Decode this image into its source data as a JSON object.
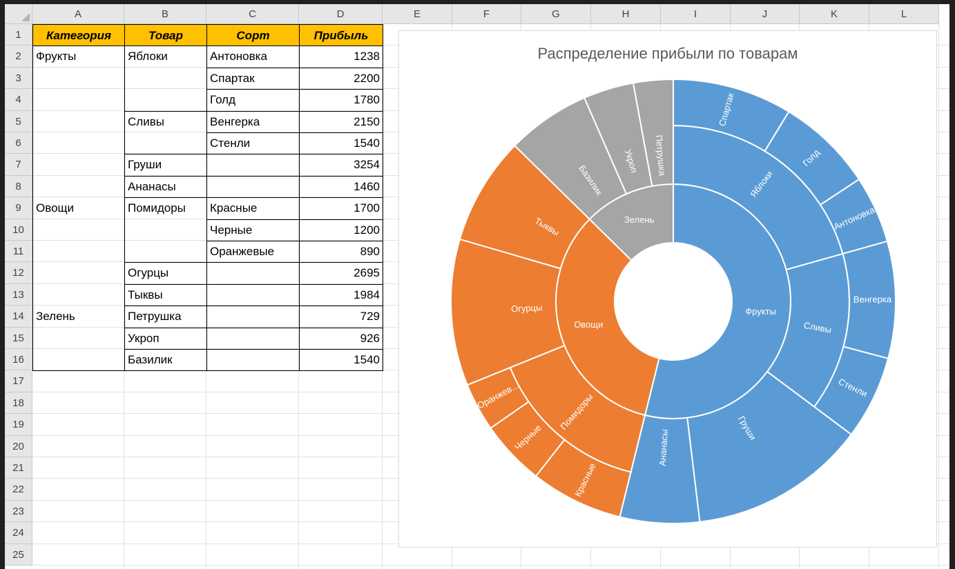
{
  "columns": [
    "A",
    "B",
    "C",
    "D",
    "E",
    "F",
    "G",
    "H",
    "I",
    "J",
    "K",
    "L"
  ],
  "rows": [
    "1",
    "2",
    "3",
    "4",
    "5",
    "6",
    "7",
    "8",
    "9",
    "10",
    "11",
    "12",
    "13",
    "14",
    "15",
    "16",
    "17",
    "18",
    "19",
    "20",
    "21",
    "22",
    "23",
    "24",
    "25"
  ],
  "table": {
    "headers": [
      "Категория",
      "Товар",
      "Сорт",
      "Прибыль"
    ],
    "rows": [
      [
        "Фрукты",
        "Яблоки",
        "Антоновка",
        "1238"
      ],
      [
        "",
        "",
        "Спартак",
        "2200"
      ],
      [
        "",
        "",
        "Голд",
        "1780"
      ],
      [
        "",
        "Сливы",
        "Венгерка",
        "2150"
      ],
      [
        "",
        "",
        "Стенли",
        "1540"
      ],
      [
        "",
        "Груши",
        "",
        "3254"
      ],
      [
        "",
        "Ананасы",
        "",
        "1460"
      ],
      [
        "Овощи",
        "Помидоры",
        "Красные",
        "1700"
      ],
      [
        "",
        "",
        "Черные",
        "1200"
      ],
      [
        "",
        "",
        "Оранжевые",
        "890"
      ],
      [
        "",
        "Огурцы",
        "",
        "2695"
      ],
      [
        "",
        "Тыквы",
        "",
        "1984"
      ],
      [
        "Зелень",
        "Петрушка",
        "",
        "729"
      ],
      [
        "",
        "Укроп",
        "",
        "926"
      ],
      [
        "",
        "Базилик",
        "",
        "1540"
      ]
    ]
  },
  "colors": {
    "fruits": "#5b9bd5",
    "vegetables": "#ed7d31",
    "greens": "#a5a5a5",
    "header_fill": "#ffc000"
  },
  "chart_data": {
    "type": "sunburst",
    "title": "Распределение прибыли по товарам",
    "hierarchy": [
      {
        "name": "Фрукты",
        "color": "#5b9bd5",
        "children": [
          {
            "name": "Яблоки",
            "children": [
              {
                "name": "Спартак",
                "value": 2200
              },
              {
                "name": "Голд",
                "value": 1780
              },
              {
                "name": "Антоновка",
                "value": 1238
              }
            ]
          },
          {
            "name": "Сливы",
            "children": [
              {
                "name": "Венгерка",
                "value": 2150
              },
              {
                "name": "Стенли",
                "value": 1540
              }
            ]
          },
          {
            "name": "Груши",
            "value": 3254
          },
          {
            "name": "Ананасы",
            "value": 1460
          }
        ]
      },
      {
        "name": "Овощи",
        "color": "#ed7d31",
        "children": [
          {
            "name": "Помидоры",
            "children": [
              {
                "name": "Красные",
                "value": 1700
              },
              {
                "name": "Черные",
                "value": 1200
              },
              {
                "name": "Оранжев...",
                "value": 890
              }
            ]
          },
          {
            "name": "Огурцы",
            "value": 2695
          },
          {
            "name": "Тыквы",
            "value": 1984
          }
        ]
      },
      {
        "name": "Зелень",
        "color": "#a5a5a5",
        "children": [
          {
            "name": "Базилик",
            "value": 1540
          },
          {
            "name": "Укроп",
            "value": 926
          },
          {
            "name": "Петрушка",
            "value": 729
          }
        ]
      }
    ]
  }
}
